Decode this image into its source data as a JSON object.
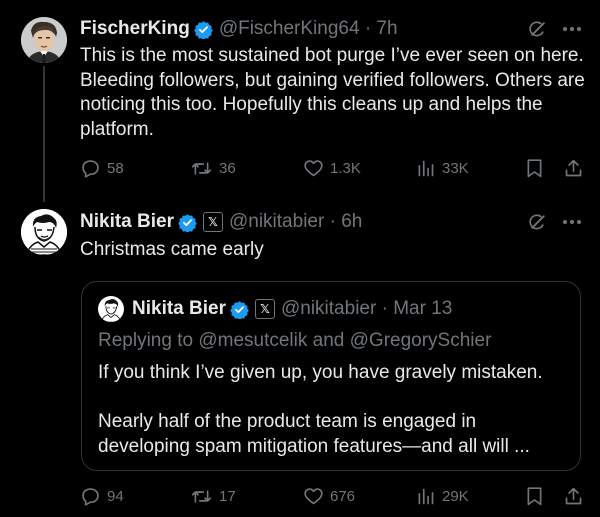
{
  "tweet1": {
    "name": "FischerKing",
    "handle": "@FischerKing64 · 7h",
    "text": "This is the most sustained bot purge I’ve ever seen on here. Bleeding followers, but gaining verified followers. Others are noticing this too. Hopefully this cleans up and helps the platform.",
    "replies": "58",
    "reposts": "36",
    "likes": "1.3K",
    "views": "33K"
  },
  "tweet2": {
    "name": "Nikita Bier",
    "handle": "@nikitabier · 6h",
    "text": "Christmas came early",
    "replies": "94",
    "reposts": "17",
    "likes": "676",
    "views": "29K",
    "quote": {
      "name": "Nikita Bier",
      "handle": "@nikitabier · Mar 13",
      "replying": "Replying to @mesutcelik and @GregorySchier",
      "line1": "If you think I’ve given up, you have gravely mistaken.",
      "line2": "Nearly half of the product team is engaged in developing spam mitigation features—and all will ..."
    }
  },
  "colors": {
    "background": "#000000",
    "text": "#e7e9ea",
    "muted": "#71767b",
    "verified": "#1d9bf0"
  }
}
